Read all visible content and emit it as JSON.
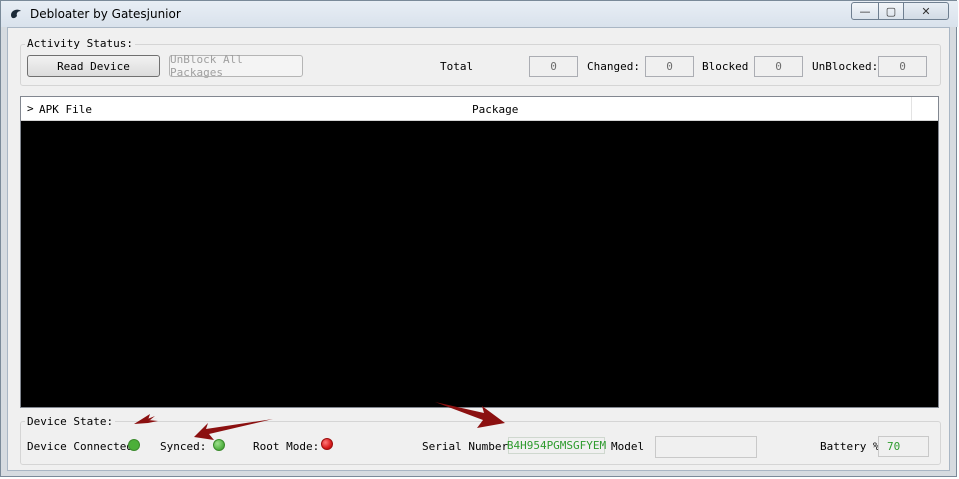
{
  "window": {
    "title": "Debloater by Gatesjunior",
    "controls": {
      "minimize": "—",
      "maximize": "▢",
      "close": "✕"
    }
  },
  "activity": {
    "label": "Activity Status:",
    "read_device": "Read Device",
    "unblock_all": "UnBlock All Packages",
    "total_label": "Total",
    "total_value": "0",
    "changed_label": "Changed:",
    "changed_value": "0",
    "blocked_label": "Blocked",
    "blocked_value": "0",
    "unblocked_label": "UnBlocked:",
    "unblocked_value": "0"
  },
  "list": {
    "columns": [
      "APK File",
      "Package"
    ],
    "expand_glyph": ">"
  },
  "device": {
    "label": "Device State:",
    "connected_label": "Device Connected:",
    "synced_label": "Synced:",
    "root_label": "Root Mode:",
    "serial_label": "Serial Number:",
    "serial_value": "B4H954PGMSGFYEM",
    "model_label": "Model",
    "model_value": "",
    "battery_label": "Battery %:",
    "battery_value": "70"
  },
  "colors": {
    "connected": "#4caf3a",
    "synced": "#58b648",
    "root": "#d91c1c",
    "arrow": "#8b1010",
    "value_green": "#2e9b2e"
  }
}
